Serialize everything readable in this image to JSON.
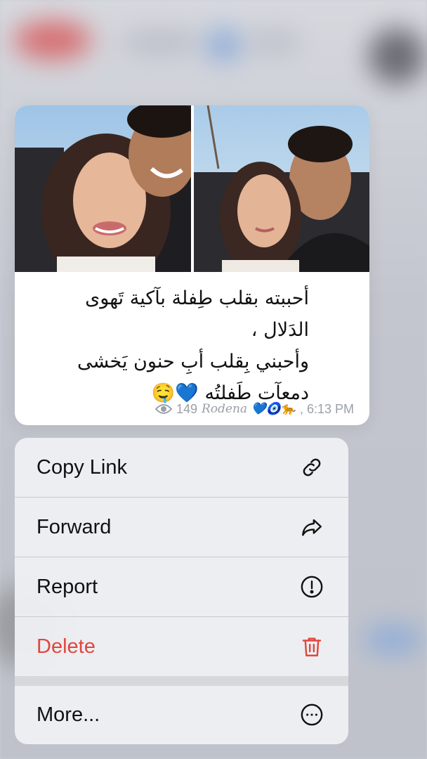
{
  "message": {
    "text_lines": [
      "أحببته بقلب طِفلة بآكية تَهوى",
      "الدَلال ،",
      "وأحبني بِقلب أبِ حنون يَخشى",
      "دمعآت طَفلتُه 💙🤤"
    ],
    "views": "149",
    "author": "Rodena 💙🧿🐆",
    "time": ", 6:13 PM"
  },
  "menu": {
    "items": [
      {
        "label": "Copy Link",
        "icon": "link-icon"
      },
      {
        "label": "Forward",
        "icon": "forward-arrow-icon"
      },
      {
        "label": "Report",
        "icon": "exclamation-circle-icon"
      },
      {
        "label": "Delete",
        "icon": "trash-icon",
        "color": "#e0473f"
      },
      {
        "label": "More...",
        "icon": "ellipsis-circle-icon"
      }
    ]
  }
}
